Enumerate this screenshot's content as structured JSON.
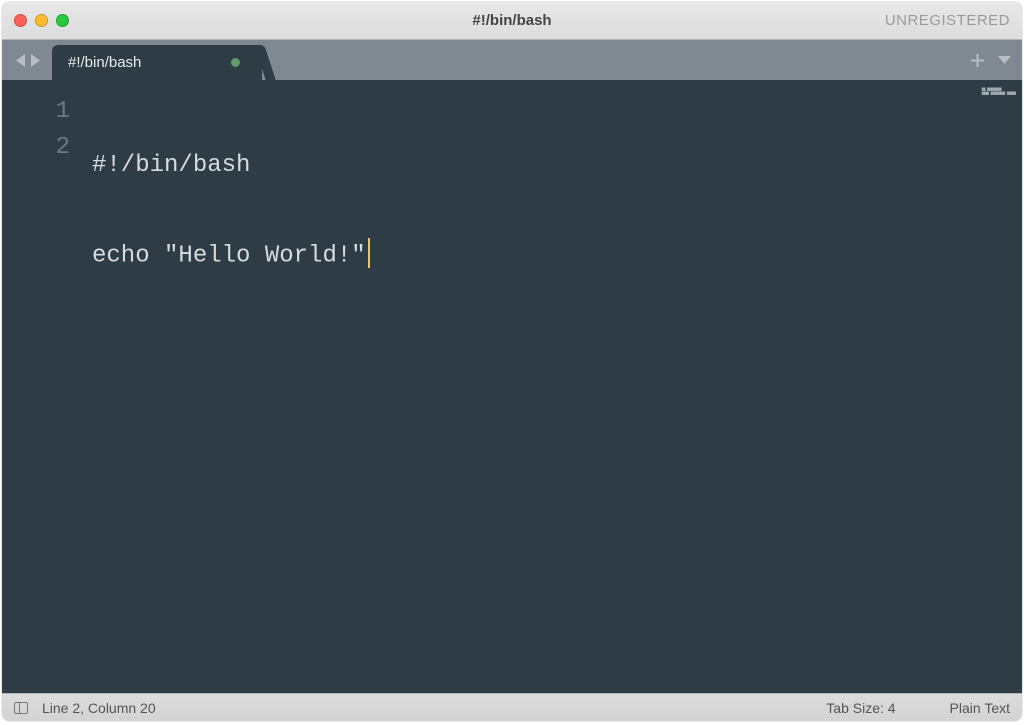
{
  "titlebar": {
    "title": "#!/bin/bash",
    "registration": "UNREGISTERED"
  },
  "tabbar": {
    "active_tab": "#!/bin/bash"
  },
  "editor": {
    "lines": [
      {
        "num": "1",
        "text": "#!/bin/bash"
      },
      {
        "num": "2",
        "text": "echo \"Hello World!\""
      }
    ],
    "cursor_line_index": 1
  },
  "statusbar": {
    "position": "Line 2, Column 20",
    "tab_size": "Tab Size: 4",
    "syntax": "Plain Text"
  }
}
